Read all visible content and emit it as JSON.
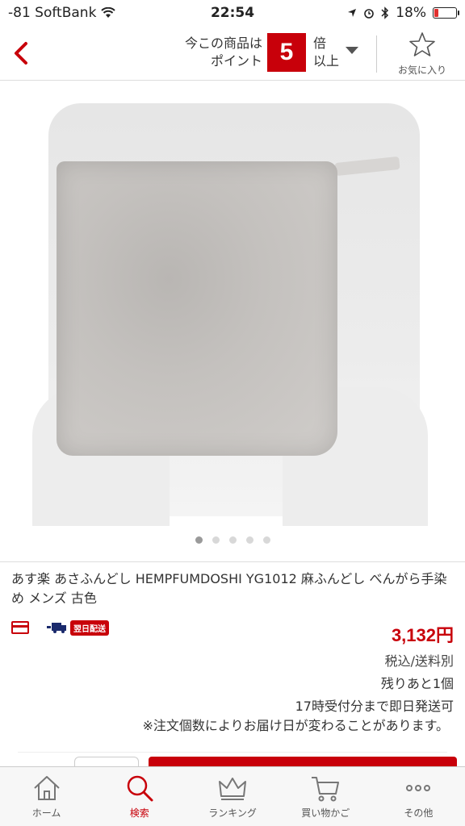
{
  "status_bar": {
    "carrier": "-81 SoftBank",
    "time": "22:54",
    "battery": "18%",
    "battery_level": 0.18
  },
  "header": {
    "point_label_line1": "今この商品は",
    "point_label_line2": "ポイント",
    "point_multiplier": "5",
    "point_suffix_line1": "倍",
    "point_suffix_line2": "以上",
    "favorite_label": "お気に入り"
  },
  "carousel": {
    "total": 5,
    "active_index": 0
  },
  "product": {
    "title": "あす楽 あさふんどし HEMPFUMDOSHI YG1012 麻ふんどし べんがら手染め メンズ 古色",
    "delivery_badge": "翌日配送",
    "price": "3,132円",
    "tax_note": "税込/送料別",
    "stock": "残りあと1個",
    "ship_note": "17時受付分まで即日発送可",
    "delivery_note": "※注文個数によりお届け日が変わることがあります。"
  },
  "tabbar": {
    "items": [
      {
        "label": "ホーム",
        "icon": "home-icon"
      },
      {
        "label": "検索",
        "icon": "search-icon",
        "active": true
      },
      {
        "label": "ランキング",
        "icon": "crown-icon"
      },
      {
        "label": "買い物かご",
        "icon": "cart-icon"
      },
      {
        "label": "その他",
        "icon": "more-icon"
      }
    ]
  },
  "colors": {
    "accent": "#c8000a"
  }
}
